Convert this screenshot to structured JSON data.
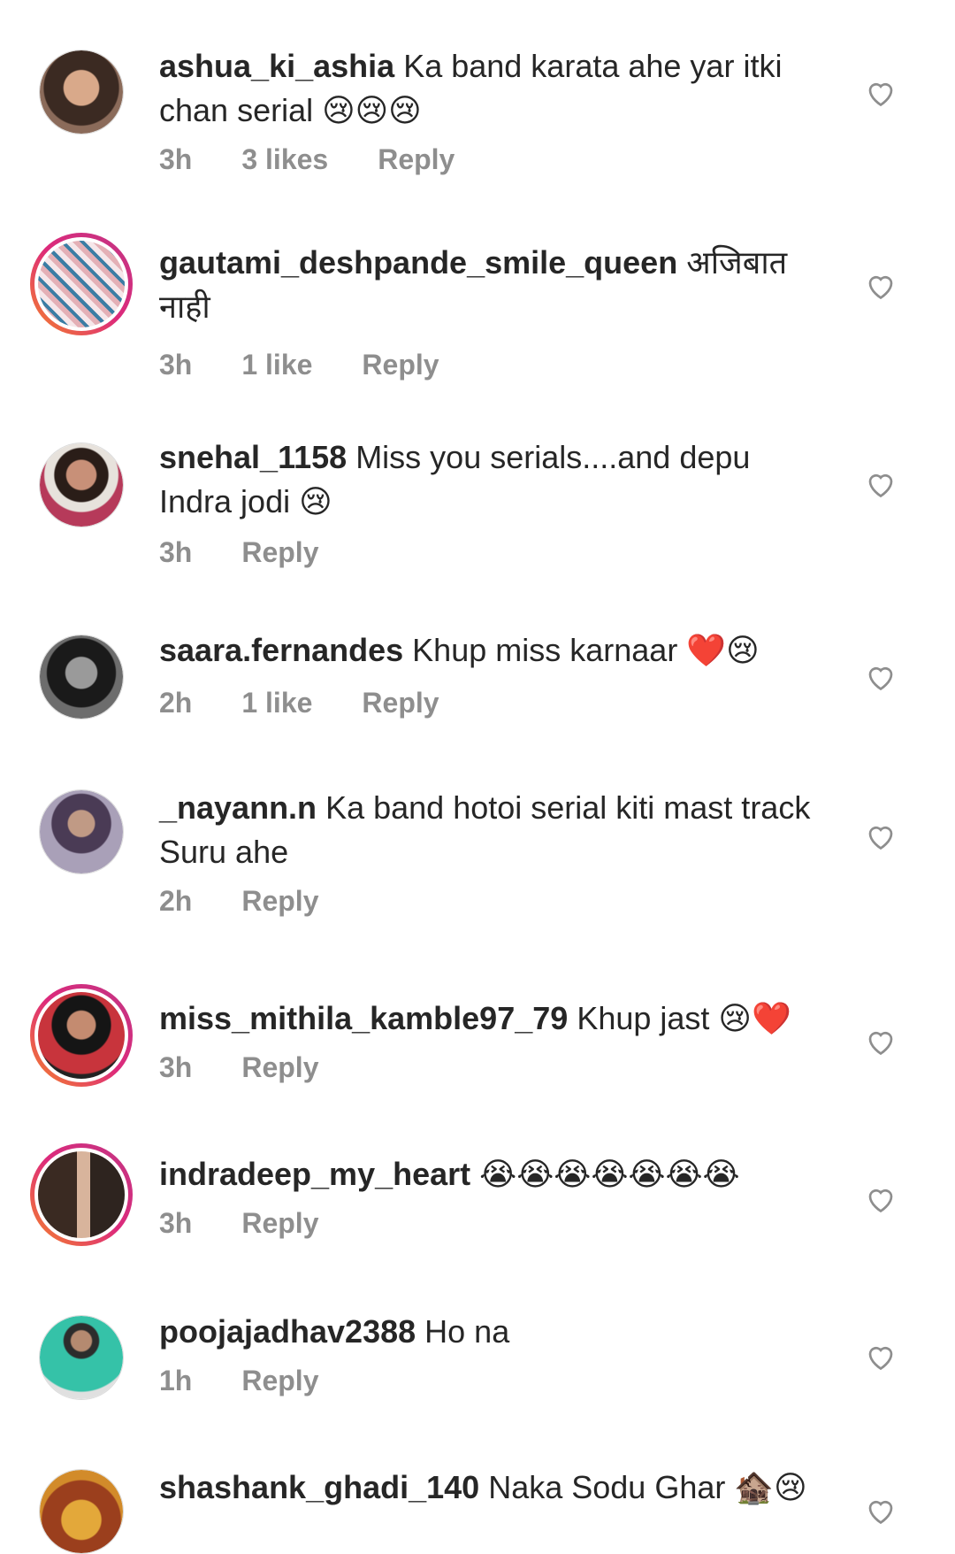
{
  "comments": [
    {
      "user": "ashua_ki_ashia",
      "text": "Ka band karata ahe yar itki chan serial 😢😢😢",
      "time": "3h",
      "likes": "3 likes",
      "reply": "Reply"
    },
    {
      "user": "gautami_deshpande_smile_queen",
      "text": "अजिबात नाही",
      "time": "3h",
      "likes": "1 like",
      "reply": "Reply"
    },
    {
      "user": "snehal_1158",
      "text": "Miss you serials....and depu Indra jodi 😢",
      "time": "3h",
      "likes": "",
      "reply": "Reply"
    },
    {
      "user": "saara.fernandes",
      "text": "Khup miss karnaar ❤️😢",
      "time": "2h",
      "likes": "1 like",
      "reply": "Reply"
    },
    {
      "user": "_nayann.n",
      "text": "Ka band hotoi serial kiti mast track Suru ahe",
      "time": "2h",
      "likes": "",
      "reply": "Reply"
    },
    {
      "user": "miss_mithila_kamble97_79",
      "text": "Khup jast 😢❤️",
      "time": "3h",
      "likes": "",
      "reply": "Reply"
    },
    {
      "user": "indradeep_my_heart",
      "text": "😭😭😭😭😭😭😭",
      "time": "3h",
      "likes": "",
      "reply": "Reply"
    },
    {
      "user": "poojajadhav2388",
      "text": "Ho na",
      "time": "1h",
      "likes": "",
      "reply": "Reply"
    },
    {
      "user": "shashank_ghadi_140",
      "text": "Naka Sodu Ghar 🏚️😢",
      "time": "",
      "likes": "",
      "reply": ""
    }
  ],
  "icons": {
    "avatar": "avatar-icon",
    "heart": "heart-outline-icon"
  },
  "colors": {
    "username": "#262626",
    "meta": "#8e8e8e",
    "story_ring_start": "#f58529",
    "story_ring_end": "#c13584"
  }
}
